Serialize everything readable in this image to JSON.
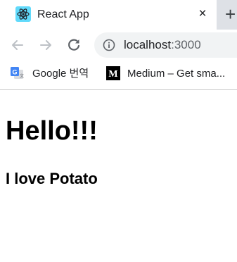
{
  "tab": {
    "title": "React App",
    "favicon": "react-logo-icon",
    "close_glyph": "×",
    "new_tab_glyph": "+"
  },
  "toolbar": {
    "back_icon": "arrow-left-icon",
    "forward_icon": "arrow-right-icon",
    "reload_icon": "reload-icon",
    "info_icon": "info-icon",
    "url_host": "localhost",
    "url_port": ":3000"
  },
  "bookmarks": [
    {
      "label": "Google 번역",
      "icon": "google-translate-icon"
    },
    {
      "label": "Medium – Get sma...",
      "icon": "medium-logo-icon"
    }
  ],
  "page": {
    "heading": "Hello!!!",
    "subheading": "I love Potato"
  },
  "colors": {
    "tabstrip": "#dee1e6",
    "omnibox": "#f1f3f4",
    "react_cyan": "#61dafb"
  }
}
